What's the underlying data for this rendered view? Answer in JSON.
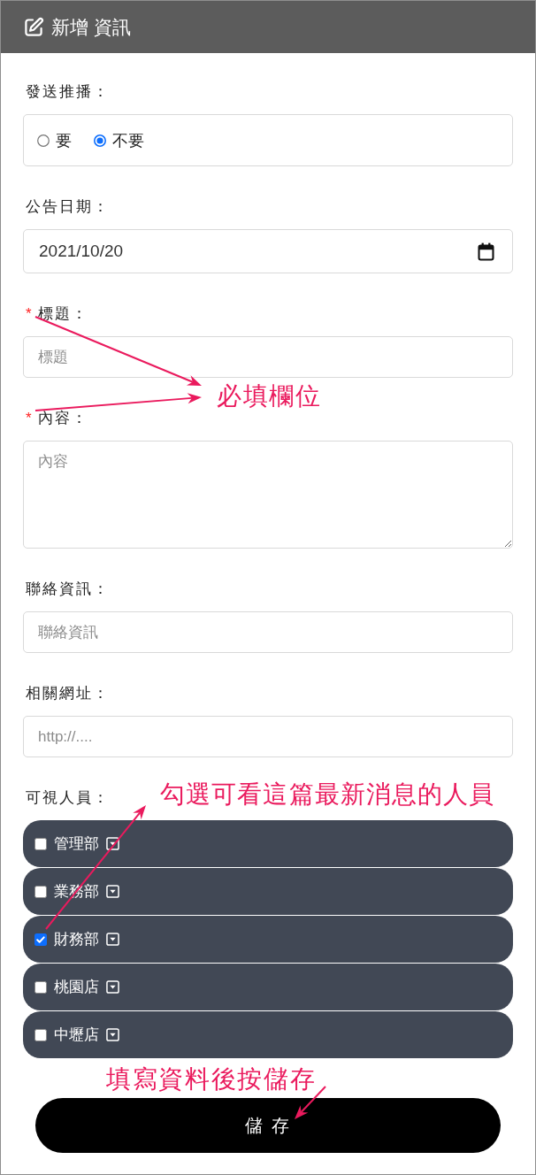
{
  "header": {
    "title": "新增 資訊"
  },
  "form": {
    "fields": [
      {
        "kind": "radio",
        "label": "發送推播：",
        "options": [
          {
            "label": "要",
            "selected": false
          },
          {
            "label": "不要",
            "selected": true
          }
        ]
      },
      {
        "kind": "date",
        "label": "公告日期：",
        "value": "2021/10/20"
      },
      {
        "kind": "text",
        "required_mark": "*",
        "label": "標題：",
        "placeholder": "標題"
      },
      {
        "kind": "textarea",
        "required_mark": "*",
        "label": "內容：",
        "placeholder": "內容"
      },
      {
        "kind": "text",
        "label": "聯絡資訊：",
        "placeholder": "聯絡資訊"
      },
      {
        "kind": "text",
        "label": "相關網址：",
        "placeholder": "http://...."
      },
      {
        "kind": "checklist",
        "label": "可視人員：",
        "items": [
          {
            "label": "管理部",
            "checked": false
          },
          {
            "label": "業務部",
            "checked": false
          },
          {
            "label": "財務部",
            "checked": true
          },
          {
            "label": "桃園店",
            "checked": false
          },
          {
            "label": "中壢店",
            "checked": false
          }
        ]
      }
    ]
  },
  "save_button": {
    "label": "儲 存"
  },
  "annotations": [
    {
      "text": "必填欄位"
    },
    {
      "text": "勾選可看這篇最新消息的人員"
    },
    {
      "text": "填寫資料後按儲存"
    }
  ]
}
